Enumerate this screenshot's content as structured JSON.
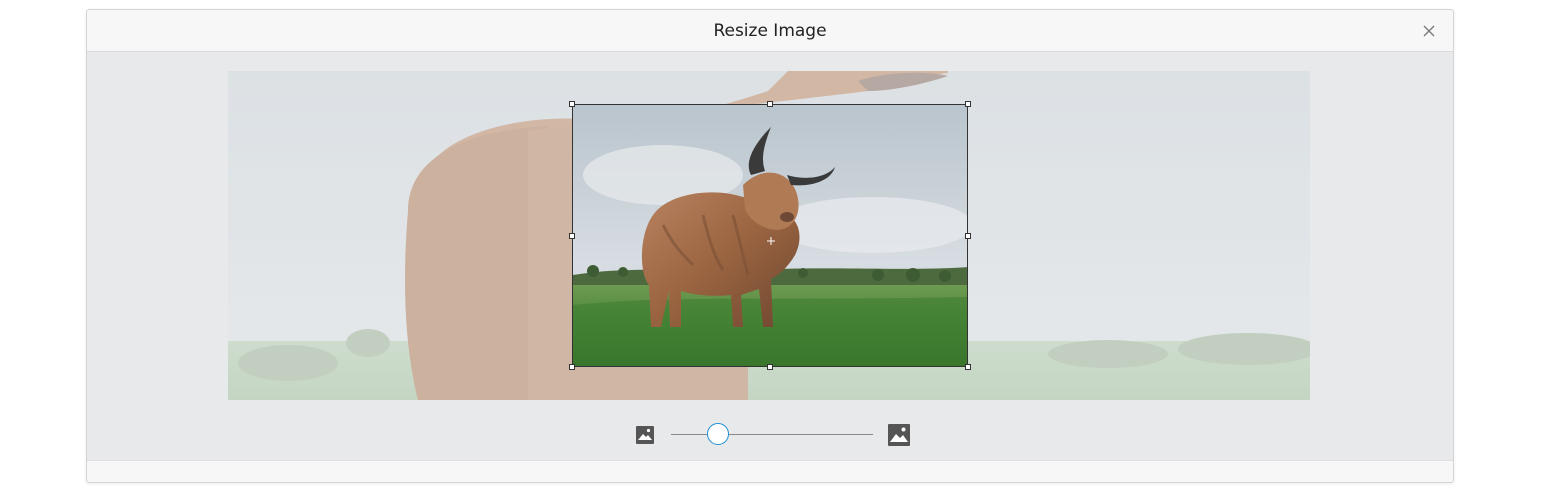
{
  "dialog": {
    "title": "Resize Image",
    "close_icon": "close-icon"
  },
  "image": {
    "subject": "highland-cow-in-grass-field"
  },
  "zoom": {
    "min_icon": "image-small-icon",
    "max_icon": "image-large-icon",
    "value_fraction": 0.24
  },
  "colors": {
    "slider_accent": "#1e8fd6",
    "dialog_bg": "#e8e9eb",
    "header_bg": "#f7f7f8"
  }
}
